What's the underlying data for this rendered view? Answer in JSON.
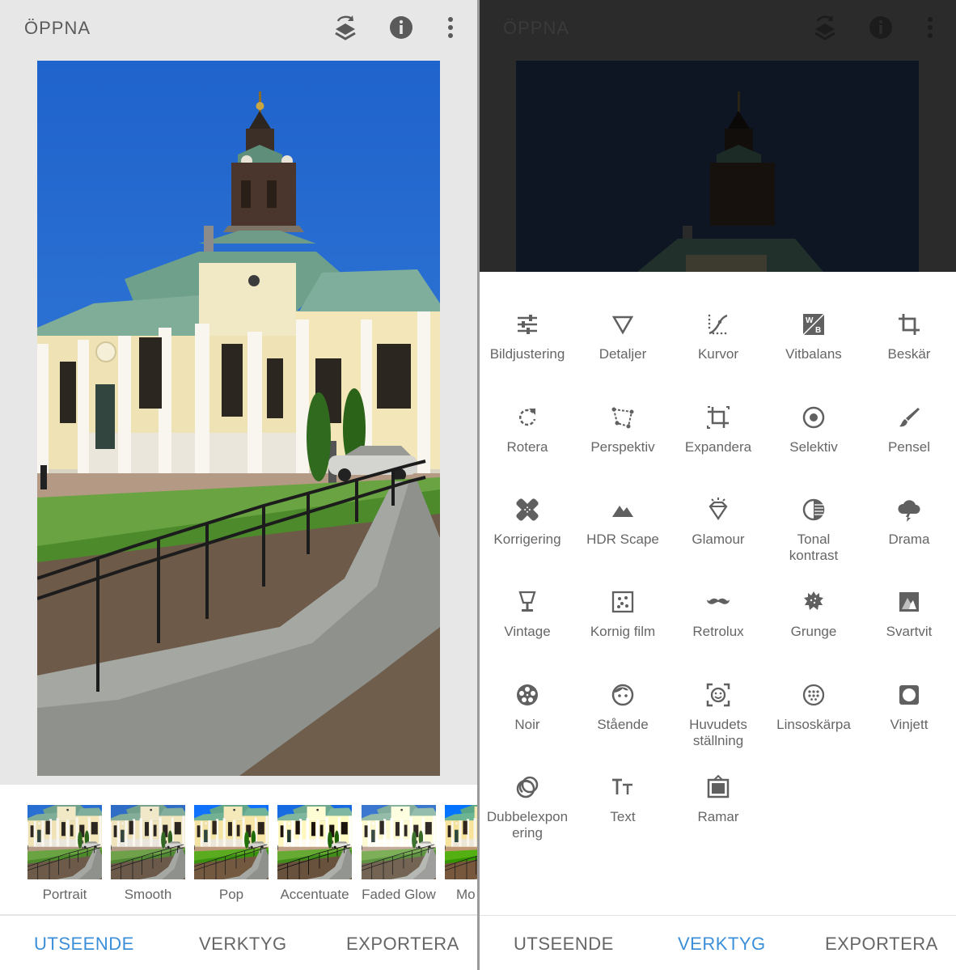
{
  "left": {
    "header": {
      "open_label": "ÖPPNA"
    },
    "looks": [
      {
        "label": "Portrait"
      },
      {
        "label": "Smooth"
      },
      {
        "label": "Pop"
      },
      {
        "label": "Accentuate"
      },
      {
        "label": "Faded Glow"
      },
      {
        "label": "Mo"
      }
    ],
    "nav": {
      "tab1": "UTSEENDE",
      "tab2": "VERKTYG",
      "tab3": "EXPORTERA",
      "active": "UTSEENDE"
    }
  },
  "right": {
    "header": {
      "open_label": "ÖPPNA"
    },
    "tools": [
      {
        "label": "Bildjustering",
        "icon": "sliders-icon"
      },
      {
        "label": "Detaljer",
        "icon": "triangle-down-icon"
      },
      {
        "label": "Kurvor",
        "icon": "curves-icon"
      },
      {
        "label": "Vitbalans",
        "icon": "white-balance-icon"
      },
      {
        "label": "Beskär",
        "icon": "crop-icon"
      },
      {
        "label": "Rotera",
        "icon": "rotate-icon"
      },
      {
        "label": "Perspektiv",
        "icon": "perspective-icon"
      },
      {
        "label": "Expandera",
        "icon": "expand-icon"
      },
      {
        "label": "Selektiv",
        "icon": "selective-icon"
      },
      {
        "label": "Pensel",
        "icon": "brush-icon"
      },
      {
        "label": "Korrigering",
        "icon": "healing-icon"
      },
      {
        "label": "HDR Scape",
        "icon": "mountain-icon"
      },
      {
        "label": "Glamour",
        "icon": "diamond-icon"
      },
      {
        "label": "Tonal\nkontrast",
        "icon": "tonal-contrast-icon"
      },
      {
        "label": "Drama",
        "icon": "cloud-icon"
      },
      {
        "label": "Vintage",
        "icon": "lamp-icon"
      },
      {
        "label": "Kornig film",
        "icon": "grain-icon"
      },
      {
        "label": "Retrolux",
        "icon": "mustache-icon"
      },
      {
        "label": "Grunge",
        "icon": "grunge-icon"
      },
      {
        "label": "Svartvit",
        "icon": "black-white-icon"
      },
      {
        "label": "Noir",
        "icon": "film-reel-icon"
      },
      {
        "label": "Stående",
        "icon": "face-icon"
      },
      {
        "label": "Huvudets\nställning",
        "icon": "head-pose-icon"
      },
      {
        "label": "Linsoskärpa",
        "icon": "lens-blur-icon"
      },
      {
        "label": "Vinjett",
        "icon": "vignette-icon"
      },
      {
        "label": "Dubbelexpon\nering",
        "icon": "double-exposure-icon"
      },
      {
        "label": "Text",
        "icon": "text-icon"
      },
      {
        "label": "Ramar",
        "icon": "frame-icon"
      }
    ],
    "nav": {
      "tab1": "UTSEENDE",
      "tab2": "VERKTYG",
      "tab3": "EXPORTERA",
      "active": "VERKTYG"
    }
  },
  "colors": {
    "accent": "#3b8fd9",
    "text": "#666666",
    "icon": "#606060"
  }
}
